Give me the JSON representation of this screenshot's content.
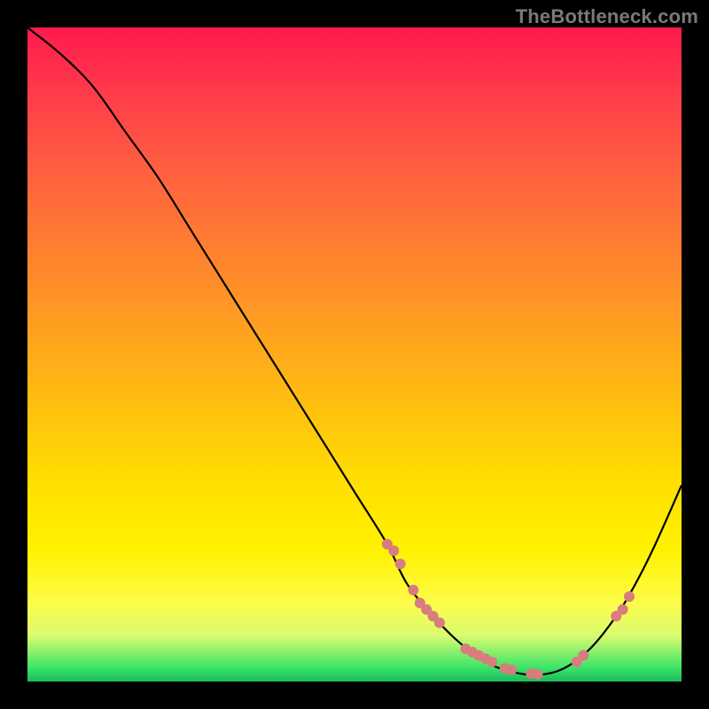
{
  "watermark": "TheBottleneck.com",
  "colors": {
    "curve": "#000000",
    "marker": "#d77d7d",
    "background_top": "#ff1a4d",
    "background_bottom": "#1cb85c",
    "page_bg": "#000000"
  },
  "chart_data": {
    "type": "line",
    "title": "",
    "xlabel": "",
    "ylabel": "",
    "xlim": [
      0,
      100
    ],
    "ylim": [
      0,
      100
    ],
    "x": [
      0,
      5,
      10,
      15,
      20,
      25,
      30,
      35,
      40,
      45,
      50,
      55,
      58,
      62,
      66,
      70,
      74,
      78,
      82,
      86,
      90,
      93,
      96,
      100
    ],
    "y": [
      100,
      96,
      91,
      84,
      77,
      69,
      61,
      53,
      45,
      37,
      29,
      21,
      15,
      10,
      6,
      3,
      1.5,
      1,
      2,
      5,
      10,
      15,
      21,
      30
    ],
    "markers": {
      "x": [
        55,
        56,
        57,
        59,
        60,
        61,
        62,
        63,
        67,
        68,
        69,
        70,
        71,
        73,
        74,
        77,
        78,
        84,
        85,
        90,
        91,
        92
      ],
      "y": [
        21,
        20,
        18,
        14,
        12,
        11,
        10,
        9,
        5,
        4.5,
        4,
        3.5,
        3,
        2,
        1.8,
        1.2,
        1.1,
        3,
        4,
        10,
        11,
        13
      ]
    }
  }
}
